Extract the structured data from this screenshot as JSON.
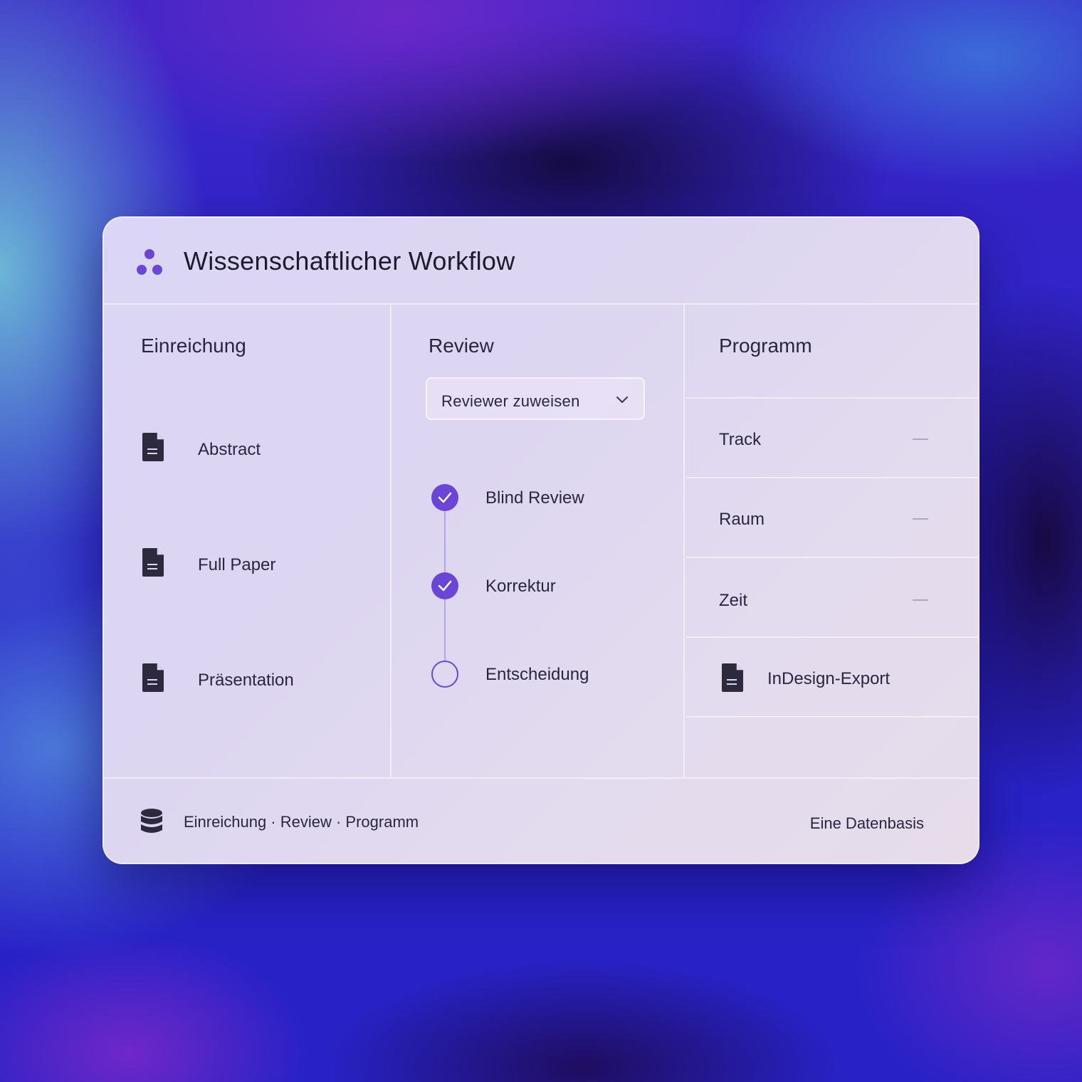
{
  "app": {
    "title": "Wissenschaftlicher Workflow",
    "accent_color": "#6b45d6",
    "logo_icon": "three-dots-logo"
  },
  "columns": {
    "submission": {
      "title": "Einreichung",
      "items": [
        {
          "label": "Abstract",
          "icon": "document-icon"
        },
        {
          "label": "Full Paper",
          "icon": "document-icon"
        },
        {
          "label": "Präsentation",
          "icon": "document-icon"
        }
      ]
    },
    "review": {
      "title": "Review",
      "dropdown": {
        "value": "Reviewer zuweisen",
        "icon": "chevron-down-icon"
      },
      "steps": [
        {
          "label": "Blind Review",
          "status": "done"
        },
        {
          "label": "Korrektur",
          "status": "done"
        },
        {
          "label": "Entscheidung",
          "status": "open"
        }
      ]
    },
    "program": {
      "title": "Programm",
      "rows": [
        {
          "label": "Track",
          "value": "—"
        },
        {
          "label": "Raum",
          "value": "—"
        },
        {
          "label": "Zeit",
          "value": "—"
        }
      ],
      "export": {
        "label": "InDesign-Export",
        "icon": "document-icon"
      }
    }
  },
  "footer": {
    "left": "Einreichung · Review · Programm",
    "right": "Eine Datenbasis",
    "icon": "database-icon"
  }
}
